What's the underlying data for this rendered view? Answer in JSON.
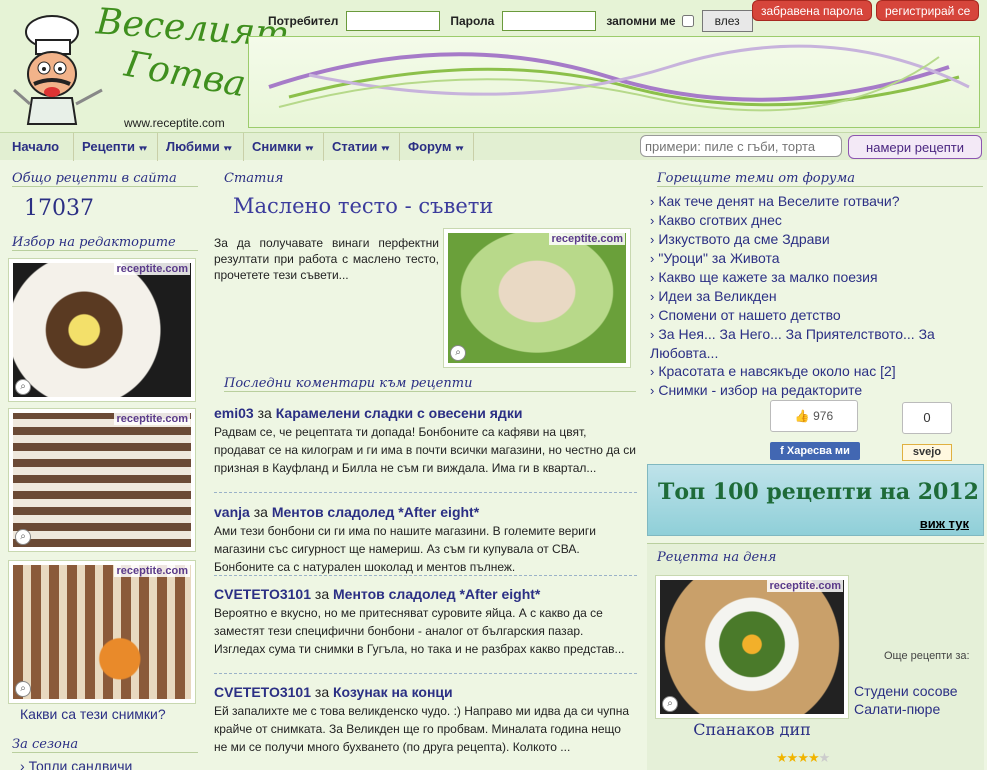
{
  "logo": {
    "title_line1": "Веселият",
    "title_line2": "Готвач",
    "url": "www.receptite.com"
  },
  "login": {
    "user_label": "Потребител",
    "password_label": "Парола",
    "remember_label": "запомни ме",
    "login_button": "влез",
    "forgot_button": "забравена парола",
    "register_button": "регистрирай се"
  },
  "nav": {
    "items": [
      {
        "label": "Начало"
      },
      {
        "label": "Рецепти",
        "dropdown": true
      },
      {
        "label": "Любими",
        "dropdown": true
      },
      {
        "label": "Снимки",
        "dropdown": true
      },
      {
        "label": "Статии",
        "dropdown": true
      },
      {
        "label": "Форум",
        "dropdown": true
      }
    ],
    "search_placeholder": "примери: пиле с гъби, торта",
    "search_button": "намери рецепти"
  },
  "left": {
    "total_label": "Общо рецепти в сайта",
    "total_value": "17037",
    "editor_title": "Избор на редакторите",
    "watermark": "receptite.com",
    "photos_link": "Какви са тези снимки?",
    "season_title": "За сезона",
    "season_items": [
      "Топли сандвичи"
    ]
  },
  "article": {
    "label": "Статия",
    "title": "Маслено тесто - съвети",
    "text": "За да получавате винаги перфектни резултати при работа с маслено тесто, прочетете тези съвети..."
  },
  "comments": {
    "title": "Последни коментари към рецепти",
    "for_word": "за",
    "items": [
      {
        "user": "emi03",
        "recipe": "Карамелени сладки с овесени ядки",
        "text": "Радвам се, че рецептата ти допада! Бонбоните са кафяви на цвят, продават се на килограм и ги има в почти всички магазини, но честно да си призная в Кауфланд и Билла не съм ги виждала. Има ги в квартал..."
      },
      {
        "user": "vanja",
        "recipe": "Ментов сладолед *After eight*",
        "text": "Ами тези бонбони си ги има по нашите магазини. В големите вериги магазини със сигурност ще намериш. Аз съм ги купувала от СВА. Бонбоните са с натурален шоколад и ментов пълнеж."
      },
      {
        "user": "CVETETO3101",
        "recipe": "Ментов сладолед *After eight*",
        "text": "Вероятно е вкусно, но ме притесняват суровите яйца. А с какво да се заместят тези специфични бонбони - аналог от българския пазар. Изгледах сума ти снимки в Гугъла, но така и не разбрах какво представ..."
      },
      {
        "user": "CVETETO3101",
        "recipe": "Козунак на конци",
        "text": "Ей запалихте ме с това великденско чудо. :) Направо ми идва да си чупна крайче от снимката. За Великден ще го пробвам. Миналата година нещо не ми се получи много бухването (по друга рецепта). Колкото ..."
      }
    ]
  },
  "forum": {
    "title": "Горещите теми от форума",
    "chevron": "›",
    "topics": [
      "Как тече денят на Веселите готвачи?",
      "Какво сготвих днес",
      "Изкуството да сме Здрави",
      "\"Уроци\" за Живота",
      "Какво ще кажете за малко поезия",
      "Идеи за Великден",
      "Спомени от нашето детство",
      "За Нея... За Него... За Приятелството... За Любовта...",
      "Красотата е навсякъде около нас [2]",
      "Снимки - избор на редакторите"
    ]
  },
  "social": {
    "like_count": "976",
    "like_label": "Харесва ми",
    "svejo_count": "0",
    "svejo_label": "svejo"
  },
  "top100": {
    "text": "Топ 100 рецепти на 2012",
    "link": "виж тук"
  },
  "daily": {
    "title": "Рецепта на деня",
    "name": "Спанаков дип",
    "rating": 4,
    "more_label": "Още рецепти за:",
    "more_links": [
      "Студени сосове",
      "Салати-пюре"
    ]
  }
}
